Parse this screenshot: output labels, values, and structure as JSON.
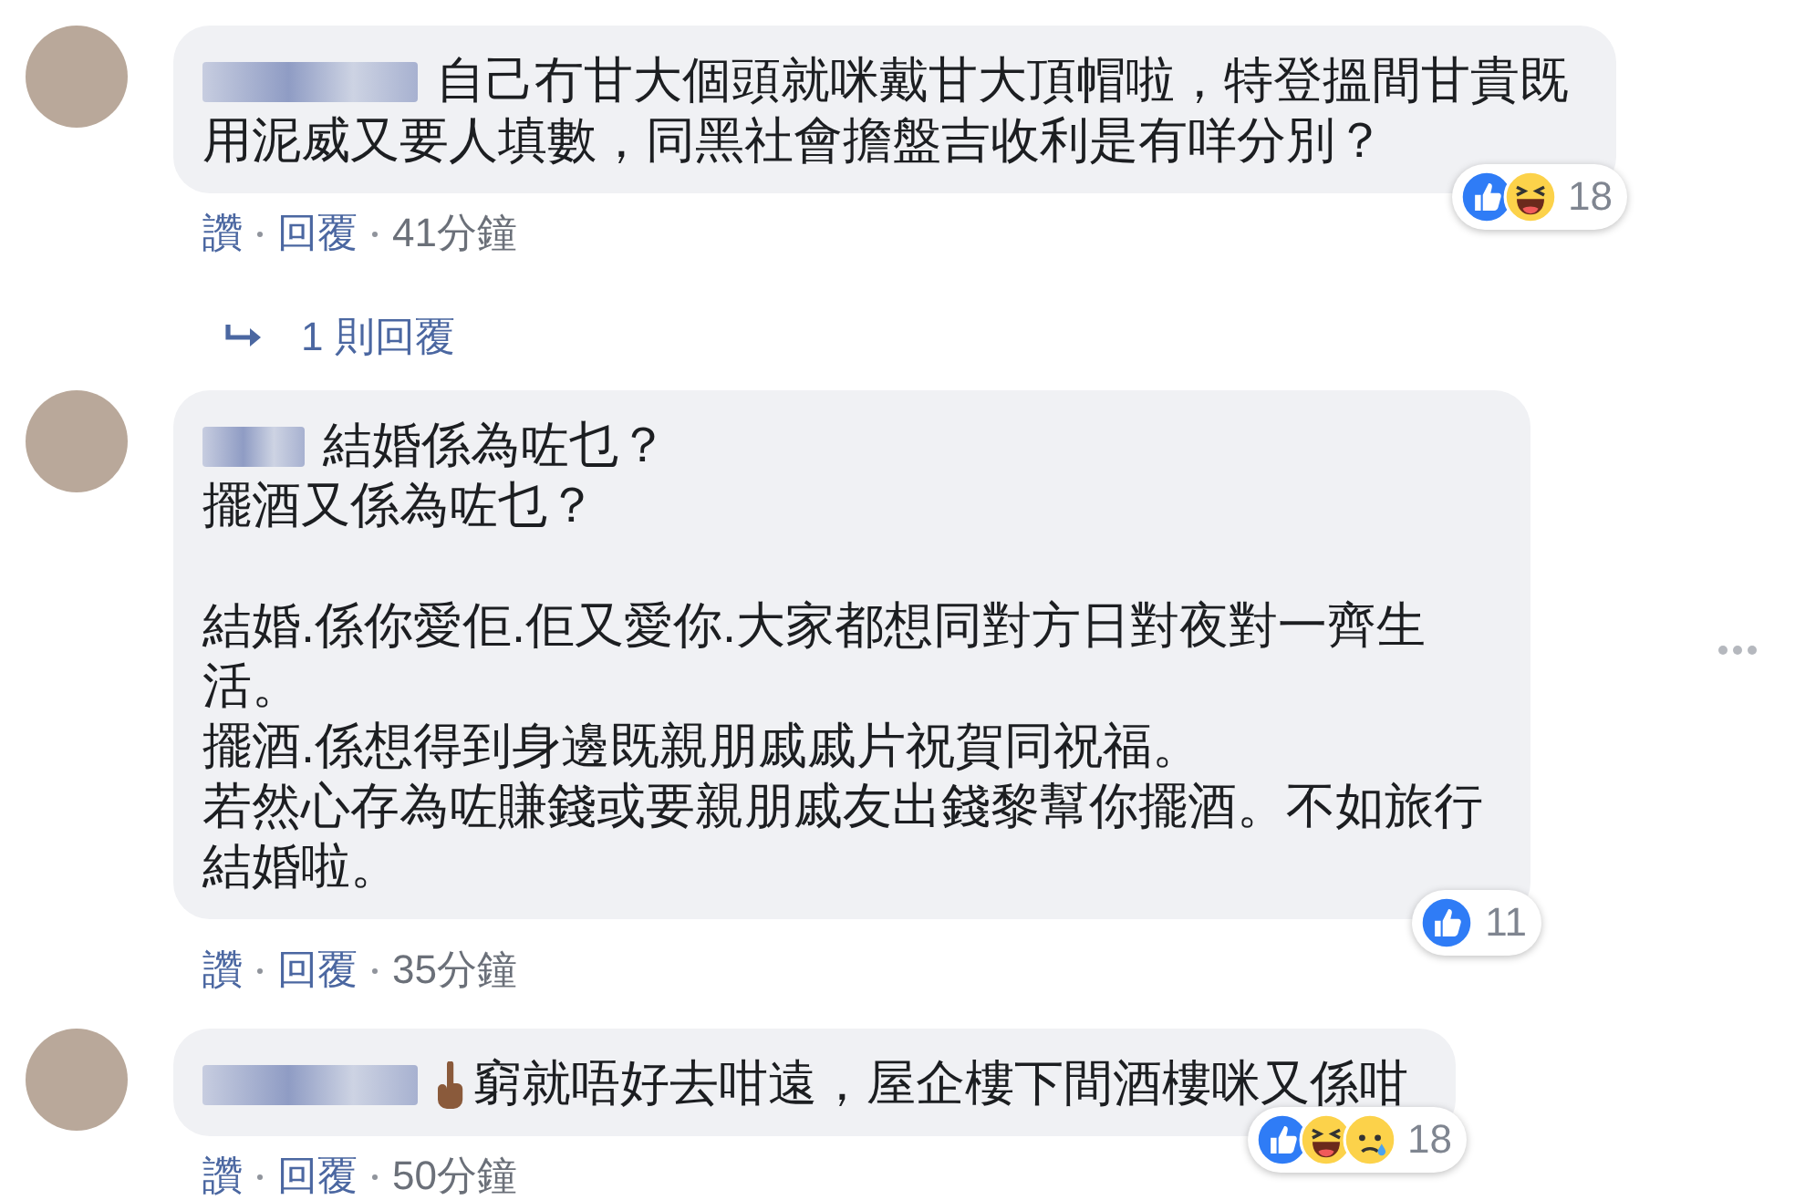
{
  "comments": [
    {
      "paragraphs": [
        [
          "自己冇甘大個頭就咪戴甘大頂帽啦，特登搵間甘貴既",
          "用泥威又要人填數，同黑社會擔盤吉收利是有咩分別？"
        ]
      ],
      "hand_icon": false,
      "reactions": [
        {
          "kind": "like"
        },
        {
          "kind": "haha"
        }
      ],
      "reaction_count": "18",
      "actions": [
        "讚",
        "回覆"
      ],
      "time": "41分鐘",
      "replies_link": "1 則回覆",
      "menu": false
    },
    {
      "paragraphs": [
        [
          "結婚係為咗乜？",
          "擺酒又係為咗乜？"
        ],
        [
          "結婚.係你愛佢.佢又愛你.大家都想同對方日對夜對一齊生",
          "活。",
          "擺酒.係想得到身邊既親朋戚戚片祝賀同祝福。",
          "若然心存為咗賺錢或要親朋戚友出錢黎幫你擺酒。不如旅行",
          "結婚啦。"
        ]
      ],
      "hand_icon": false,
      "reactions": [
        {
          "kind": "like"
        }
      ],
      "reaction_count": "11",
      "actions": [
        "讚",
        "回覆"
      ],
      "time": "35分鐘",
      "menu": true
    },
    {
      "paragraphs": [
        [
          "窮就唔好去咁遠，屋企樓下間酒樓咪又係咁"
        ]
      ],
      "hand_icon": true,
      "reactions": [
        {
          "kind": "like"
        },
        {
          "kind": "haha"
        },
        {
          "kind": "sad"
        }
      ],
      "reaction_count": "18",
      "actions": [
        "讚",
        "回覆"
      ],
      "time": "50分鐘",
      "menu": false
    }
  ]
}
